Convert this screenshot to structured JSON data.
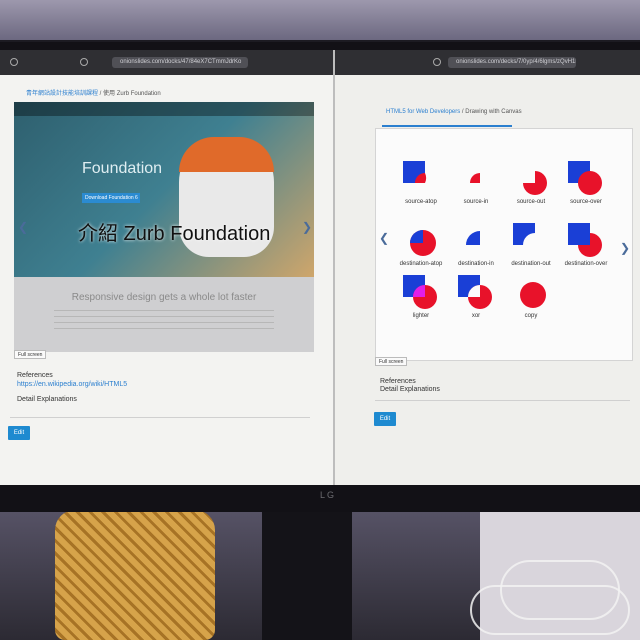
{
  "left_pane": {
    "url": "onionslides.com/docks/47/84eX7CTmmJdrKo",
    "breadcrumb_course": "青年網站設計技能培訓課程",
    "breadcrumb_sep": " / ",
    "breadcrumb_page": "使用 Zurb Foundation",
    "slide": {
      "hero_title": "Foundation",
      "hero_button": "Download Foundation 6",
      "title": "介紹 Zurb Foundation",
      "subtitle": "Responsive design gets a whole lot faster"
    },
    "fullscreen_label": "Full screen",
    "references_heading": "References",
    "reference_link": "https://en.wikipedia.org/wiki/HTML5",
    "detail_heading": "Detail Explanations",
    "edit_label": "Edit"
  },
  "right_pane": {
    "url": "onionslides.com/decks/7/0yp/4/6lgms/zQvH1K/YgrUSMA",
    "breadcrumb_course": "HTML5 for Web Developers",
    "breadcrumb_sep": " / ",
    "breadcrumb_page": "Drawing with Canvas",
    "composite_labels": [
      "source-atop",
      "source-in",
      "source-out",
      "source-over",
      "destination-atop",
      "destination-in",
      "destination-out",
      "destination-over",
      "lighter",
      "xor",
      "copy"
    ],
    "fullscreen_label": "Full screen",
    "references_heading": "References",
    "detail_heading": "Detail Explanations",
    "edit_label": "Edit"
  },
  "monitor": {
    "brand": "LG"
  },
  "colors": {
    "blue": "#1a3fd6",
    "red": "#e8122a",
    "magenta": "#e21ee8",
    "accent": "#1e8ad0"
  }
}
